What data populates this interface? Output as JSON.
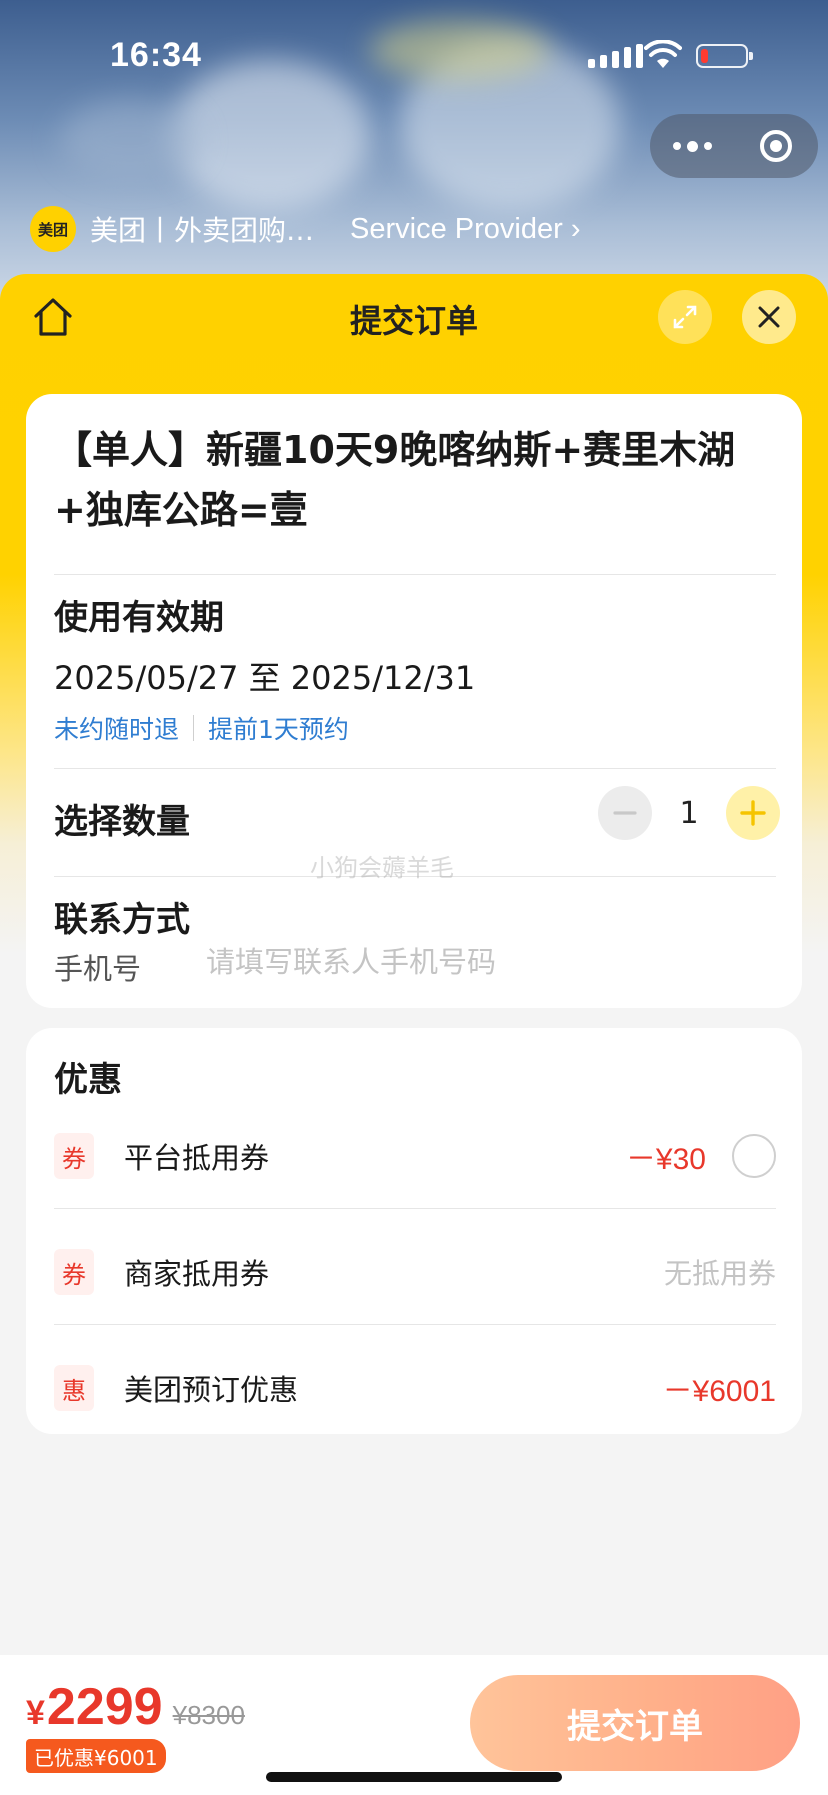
{
  "status_bar": {
    "time": "16:34"
  },
  "mini_program": {
    "logo_text": "美团",
    "name": "美团丨外卖团购…",
    "provider": "Service Provider ›"
  },
  "sheet": {
    "title": "提交订单"
  },
  "product": {
    "title": "【单人】新疆10天9晚喀纳斯+赛里木湖+独库公路=壹",
    "validity_label": "使用有效期",
    "validity_range": "2025/05/27 至 2025/12/31",
    "tags": [
      "未约随时退",
      "提前1天预约"
    ]
  },
  "quantity": {
    "label": "选择数量",
    "value": "1"
  },
  "contact": {
    "label": "联系方式",
    "phone_label": "手机号",
    "phone_placeholder": "请填写联系人手机号码",
    "phone_value": ""
  },
  "watermark": "小狗会薅羊毛",
  "discounts": {
    "title": "优惠",
    "rows": [
      {
        "tag": "券",
        "label": "平台抵用券",
        "amount": "－¥30"
      },
      {
        "tag": "券",
        "label": "商家抵用券",
        "amount": "无抵用券"
      },
      {
        "tag": "惠",
        "label": "美团预订优惠",
        "amount": "－¥6001"
      }
    ]
  },
  "bottom_bar": {
    "currency": "¥",
    "price": "2299",
    "original_price": "¥8300",
    "saved": "已优惠¥6001",
    "submit_label": "提交订单"
  },
  "colors": {
    "brand_yellow": "#ffd100",
    "price_red": "#e8382b",
    "link_blue": "#2f7dd1",
    "submit_orange": "#ffb08a"
  }
}
